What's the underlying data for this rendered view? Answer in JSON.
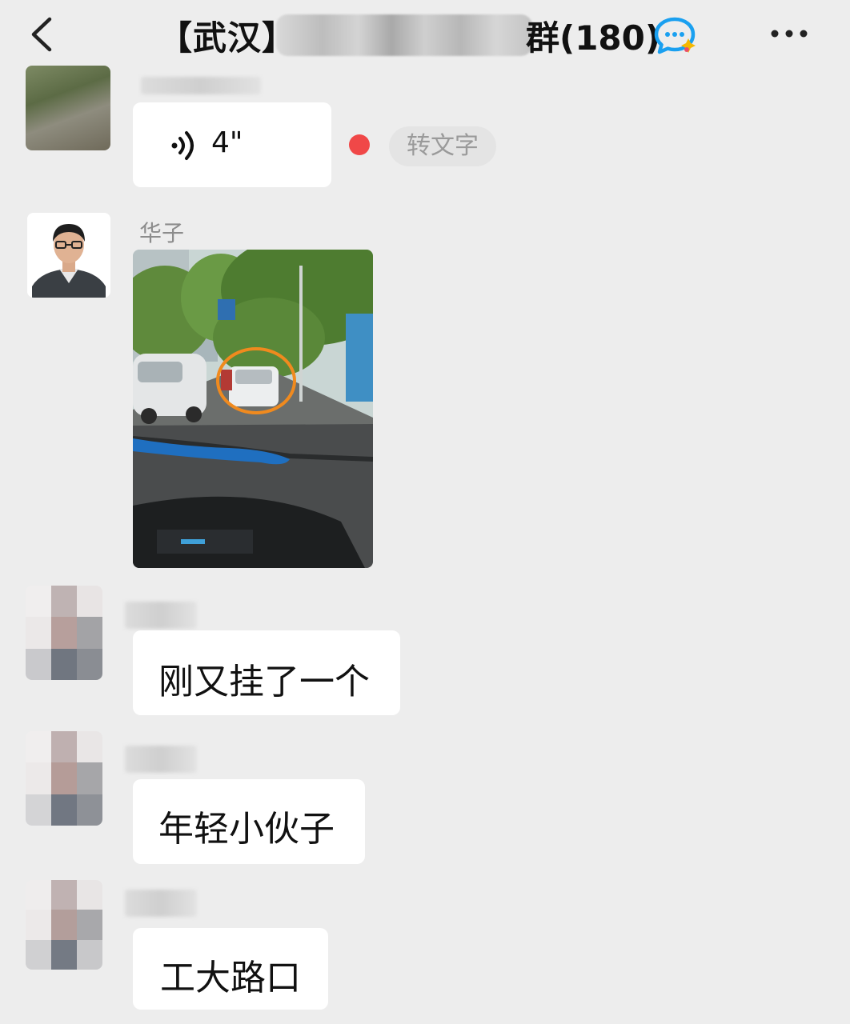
{
  "header": {
    "title_prefix": "【武汉】",
    "title_suffix": "群(180)"
  },
  "messages": [
    {
      "type": "voice",
      "sender_name": "",
      "duration": "4\"",
      "convert_label": "转文字",
      "unread": true
    },
    {
      "type": "image",
      "sender_name": "华子"
    },
    {
      "type": "text",
      "sender_name": "",
      "text": "刚又挂了一个"
    },
    {
      "type": "text",
      "sender_name": "",
      "text": "年轻小伙子"
    },
    {
      "type": "text",
      "sender_name": "",
      "text": "工大路口"
    }
  ],
  "colors": {
    "background": "#ededed",
    "bubble": "#ffffff",
    "unread_dot": "#f04848",
    "name_gray": "#8c8c8c"
  },
  "icons": [
    "back-arrow-icon",
    "group-chat-icon",
    "more-icon",
    "voice-wave-icon"
  ]
}
